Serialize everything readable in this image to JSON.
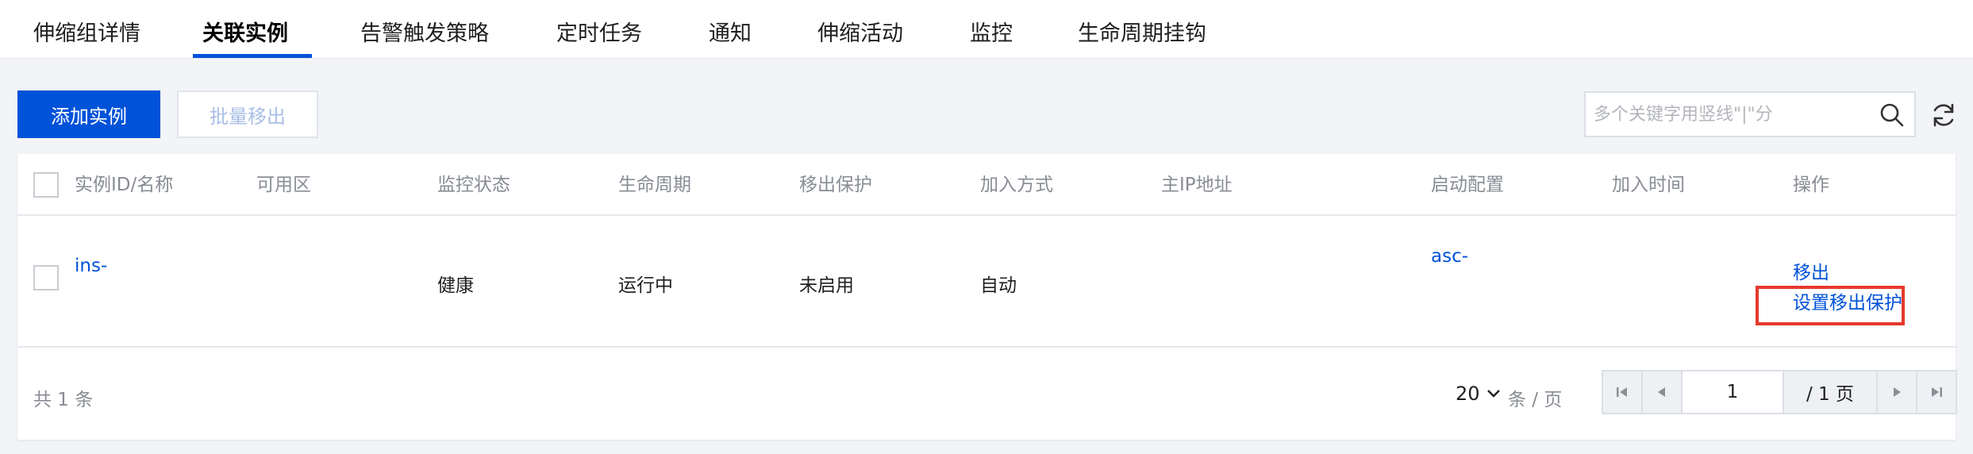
{
  "tabs": [
    {
      "label": "伸缩组详情"
    },
    {
      "label": "关联实例",
      "active": true
    },
    {
      "label": "告警触发策略"
    },
    {
      "label": "定时任务"
    },
    {
      "label": "通知"
    },
    {
      "label": "伸缩活动"
    },
    {
      "label": "监控"
    },
    {
      "label": "生命周期挂钩"
    }
  ],
  "toolbar": {
    "add_label": "添加实例",
    "batch_remove_label": "批量移出",
    "search_placeholder": "多个关键字用竖线\"|\"分"
  },
  "table": {
    "headers": [
      "实例ID/名称",
      "可用区",
      "监控状态",
      "生命周期",
      "移出保护",
      "加入方式",
      "主IP地址",
      "启动配置",
      "加入时间",
      "操作"
    ],
    "rows": [
      {
        "instance_id": "ins-",
        "zone": "",
        "monitor_status": "健康",
        "lifecycle": "运行中",
        "protection": "未启用",
        "join_method": "自动",
        "ip": "",
        "launch_config": "asc-",
        "join_time": "",
        "actions": [
          "移出",
          "设置移出保护"
        ]
      }
    ]
  },
  "footer": {
    "total": "共 1 条",
    "page_size": "20",
    "per_page": "条 / 页",
    "page_input": "1",
    "page_total": "/ 1 页"
  },
  "colors": {
    "primary": "#0052d9",
    "highlight": "#e53a2e"
  }
}
